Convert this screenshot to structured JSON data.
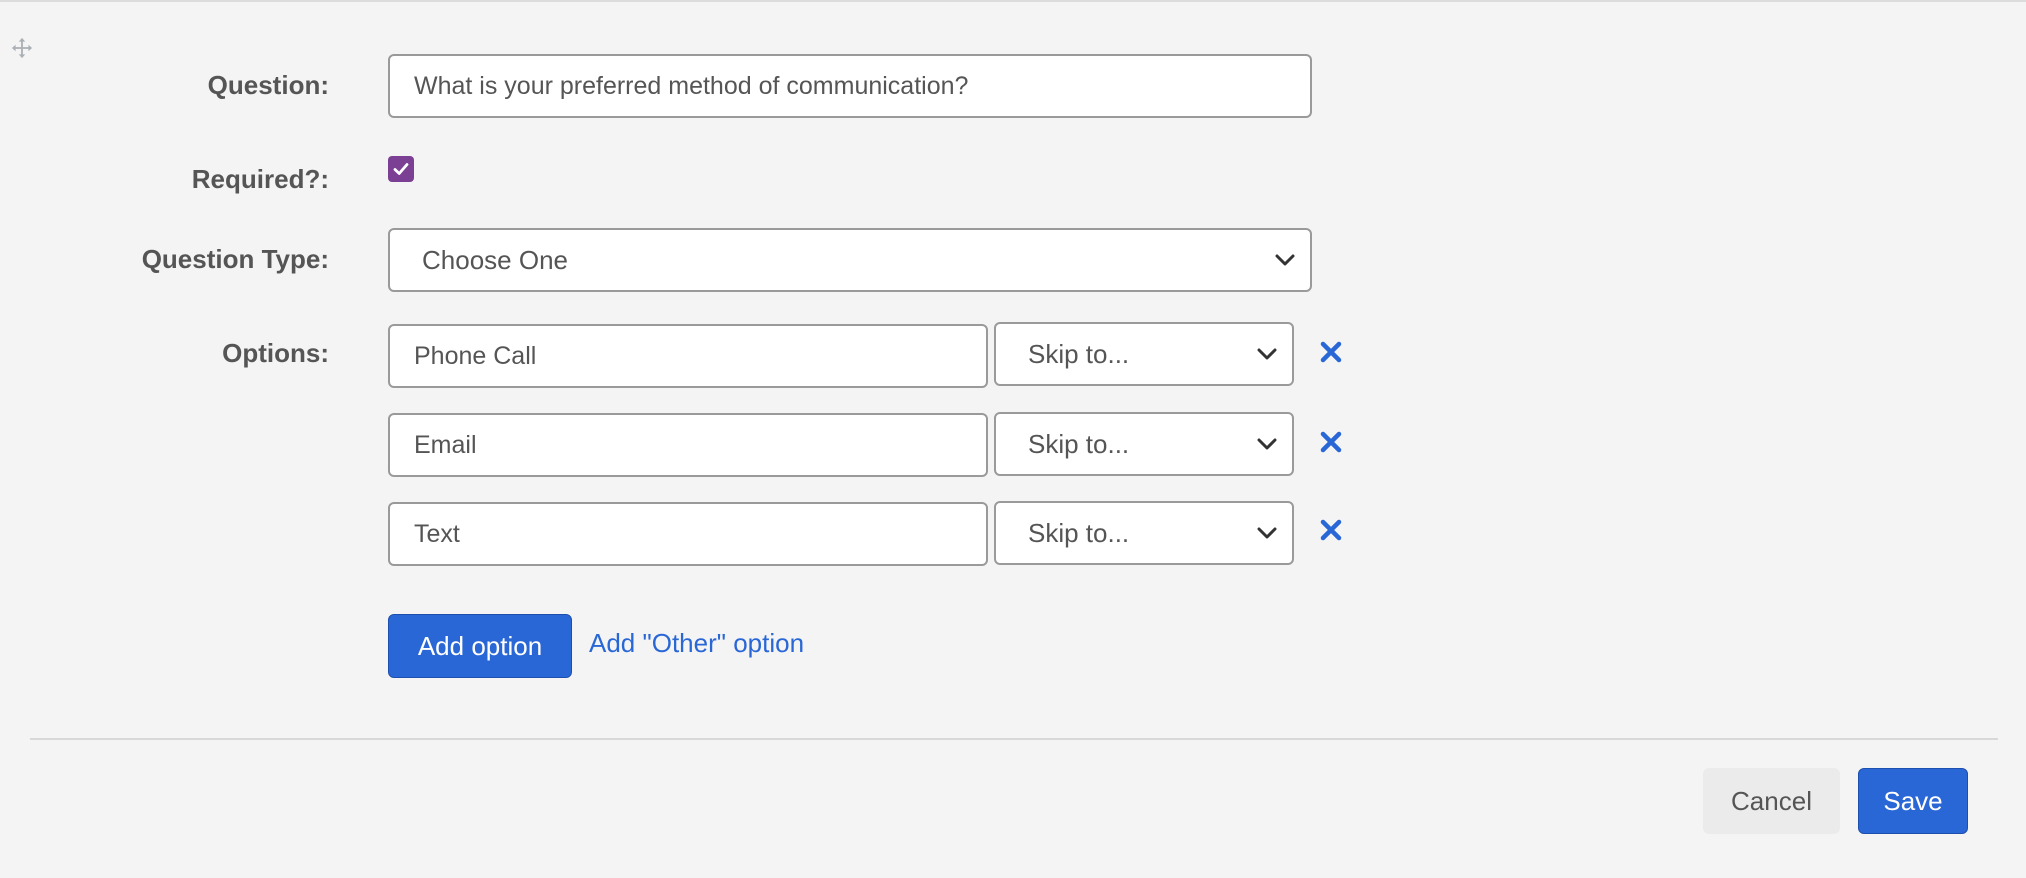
{
  "form": {
    "question_label": "Question:",
    "question_value": "What is your preferred method of communication?",
    "required_label": "Required?:",
    "required_checked": true,
    "question_type_label": "Question Type:",
    "question_type_value": "Choose One",
    "options_label": "Options:",
    "options": [
      {
        "value": "Phone Call",
        "skip": "Skip to..."
      },
      {
        "value": "Email",
        "skip": "Skip to..."
      },
      {
        "value": "Text",
        "skip": "Skip to..."
      }
    ],
    "add_option_label": "Add option",
    "add_other_option_label": "Add \"Other\" option"
  },
  "footer": {
    "cancel_label": "Cancel",
    "save_label": "Save"
  },
  "colors": {
    "background": "#f4f4f4",
    "primary": "#2a67d6",
    "checkbox": "#7b3f94",
    "label_text": "#555555"
  },
  "icons": {
    "drag": "move-arrows-icon",
    "remove": "close-x-icon",
    "select": "chevron-down-icon",
    "check": "checkmark-icon"
  }
}
